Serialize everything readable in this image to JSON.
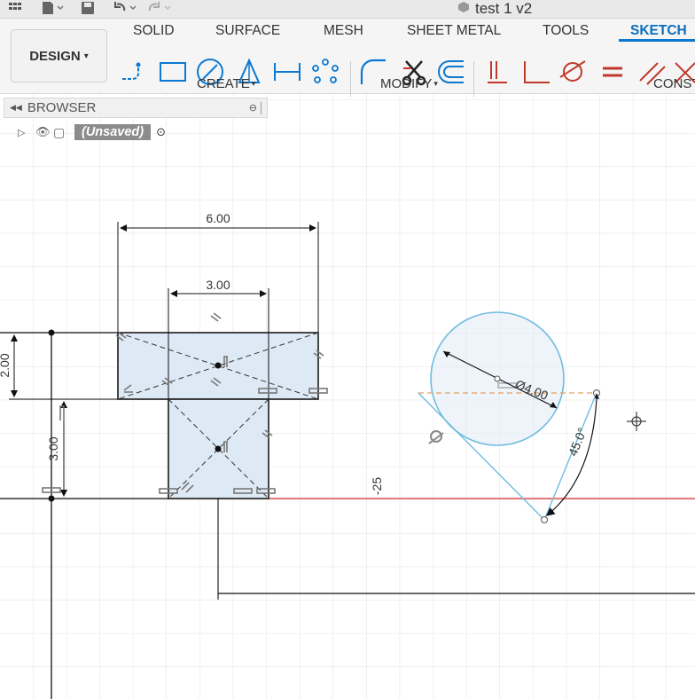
{
  "titlebar": {
    "doc_title": "test 1 v2",
    "icons": [
      "grid-icon",
      "file-icon",
      "save-icon",
      "undo-icon",
      "redo-icon",
      "cube-icon"
    ]
  },
  "ribbon": {
    "design_label": "DESIGN",
    "design_caret": "▾",
    "tabs": [
      {
        "label": "SOLID",
        "active": false
      },
      {
        "label": "SURFACE",
        "active": false
      },
      {
        "label": "MESH",
        "active": false
      },
      {
        "label": "SHEET METAL",
        "active": false
      },
      {
        "label": "TOOLS",
        "active": false
      },
      {
        "label": "SKETCH",
        "active": true
      }
    ],
    "groups": [
      {
        "label": "CREATE",
        "caret": "▾"
      },
      {
        "label": "MODIFY",
        "caret": "▾"
      },
      {
        "label": "CONST"
      }
    ],
    "accent": "#0b78d1"
  },
  "browser": {
    "title": "BROWSER",
    "item_label": "(Unsaved)"
  },
  "sketch": {
    "dimensions": {
      "top_width": "6.00",
      "inner_width": "3.00",
      "left_height": "2.00",
      "lower_height": "3.00",
      "circle_diameter": "Ø4.00",
      "angle": "45.0°",
      "offset": "-25"
    },
    "colors": {
      "line": "#1a1a1a",
      "fill": "#dde9f4",
      "circle": "#6fbce0",
      "axis": "#e05050",
      "construction": "#e2a060"
    }
  }
}
